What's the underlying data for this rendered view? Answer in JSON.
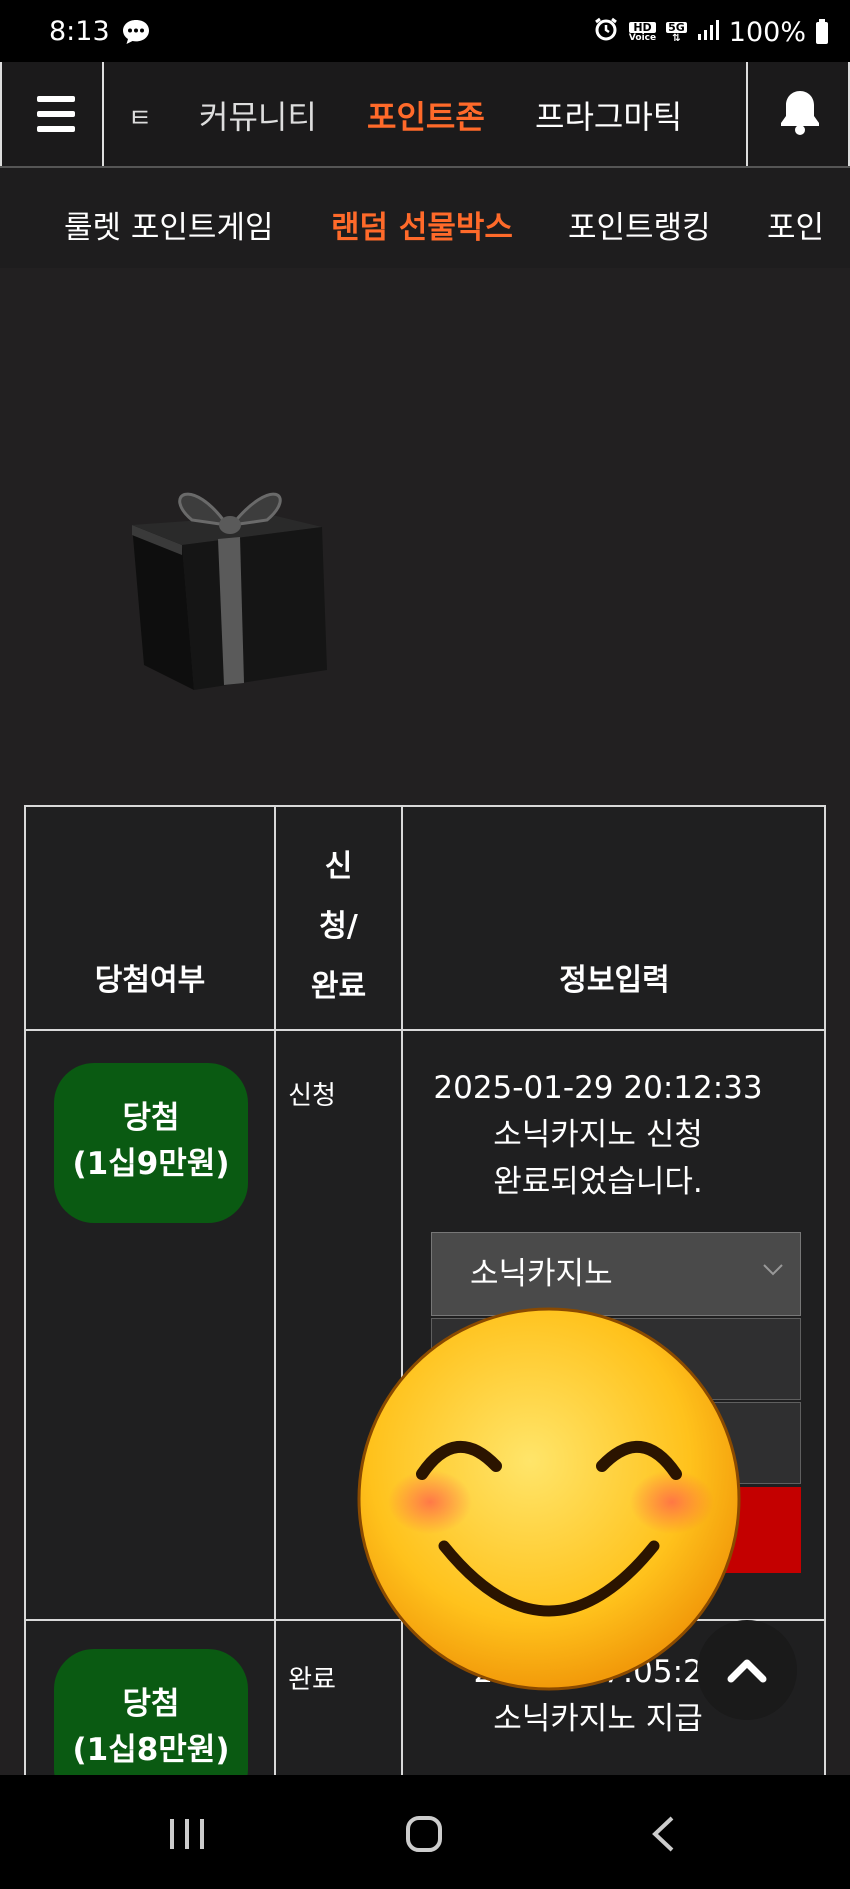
{
  "status_bar": {
    "time": "8:13",
    "hd_label": "HD",
    "voice_label": "Voice",
    "network": "5G",
    "battery": "100%"
  },
  "top_nav": {
    "items": [
      "ㅌ",
      "커뮤니티",
      "포인트존",
      "프라그마틱"
    ],
    "active_index": 2
  },
  "sub_nav": {
    "items": [
      "룰렛 포인트게임",
      "랜덤 선물박스",
      "포인트랭킹",
      "포인"
    ],
    "active_index": 1
  },
  "table": {
    "headers": {
      "result": "당첨여부",
      "status_lines": [
        "신",
        "청/",
        "완료"
      ],
      "info": "정보입력"
    },
    "rows": [
      {
        "badge_lines": [
          "당첨",
          "(1십9만원)"
        ],
        "status": "신청",
        "info_lines": [
          "2025-01-29 20:12:33",
          "소닉카지노 신청",
          "완료되었습니다."
        ],
        "select_value": "소닉카지노"
      },
      {
        "badge_lines": [
          "당첨",
          "(1십8만원)"
        ],
        "status": "완료",
        "info_lines": [
          "20   -01 17:05:23",
          "소닉카지노 지급"
        ]
      }
    ]
  },
  "colors": {
    "accent": "#ff6a2a",
    "badge_green": "#0a5a12",
    "submit_red": "#c40000",
    "background": "#222021"
  }
}
